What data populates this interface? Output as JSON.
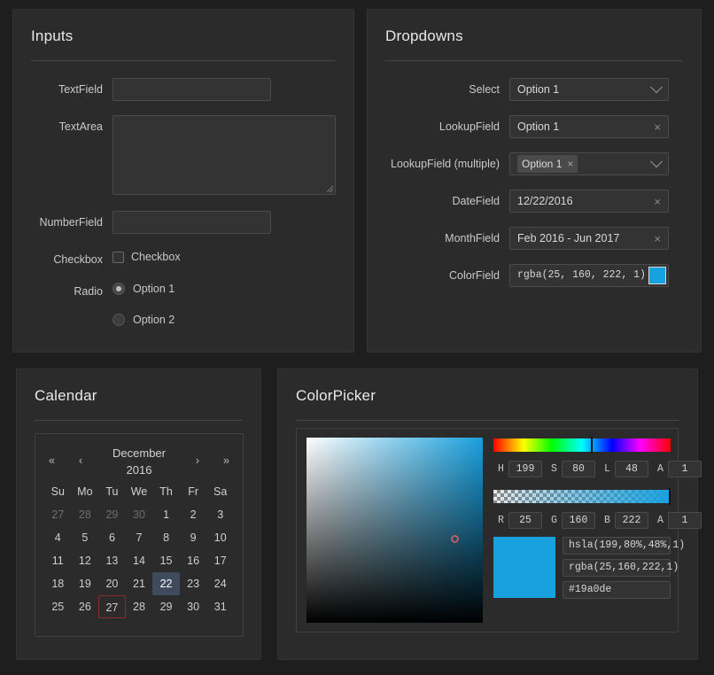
{
  "panels": {
    "inputs": {
      "title": "Inputs"
    },
    "dropdowns": {
      "title": "Dropdowns"
    },
    "calendar": {
      "title": "Calendar"
    },
    "colorpicker": {
      "title": "ColorPicker"
    }
  },
  "inputs": {
    "textfield": {
      "label": "TextField",
      "value": "",
      "placeholder": ""
    },
    "textarea": {
      "label": "TextArea",
      "value": "",
      "placeholder": ""
    },
    "numberfield": {
      "label": "NumberField",
      "value": "",
      "placeholder": ""
    },
    "checkbox": {
      "label": "Checkbox",
      "text": "Checkbox",
      "checked": false
    },
    "radio": {
      "label": "Radio",
      "options": [
        {
          "text": "Option 1",
          "selected": true
        },
        {
          "text": "Option 2",
          "selected": false
        }
      ]
    }
  },
  "dropdowns": {
    "select": {
      "label": "Select",
      "value": "Option 1",
      "caret": "chevron-down-icon"
    },
    "lookup": {
      "label": "LookupField",
      "value": "Option 1",
      "clear": "×"
    },
    "lookup_multiple": {
      "label": "LookupField (multiple)",
      "tag": "Option 1",
      "tag_remove": "×",
      "caret": "chevron-down-icon"
    },
    "datefield": {
      "label": "DateField",
      "value": "12/22/2016",
      "clear": "×"
    },
    "monthfield": {
      "label": "MonthField",
      "value": "Feb 2016 - Jun 2017",
      "clear": "×"
    },
    "colorfield": {
      "label": "ColorField",
      "value": "rgba(25, 160, 222, 1)",
      "swatch": "#19a0de"
    }
  },
  "calendar": {
    "month": "December",
    "year": "2016",
    "nav": {
      "first": "«",
      "prev": "‹",
      "next": "›",
      "last": "»"
    },
    "dow": [
      "Su",
      "Mo",
      "Tu",
      "We",
      "Th",
      "Fr",
      "Sa"
    ],
    "weeks": [
      [
        {
          "d": "27",
          "m": true
        },
        {
          "d": "28",
          "m": true
        },
        {
          "d": "29",
          "m": true
        },
        {
          "d": "30",
          "m": true
        },
        {
          "d": "1"
        },
        {
          "d": "2"
        },
        {
          "d": "3"
        }
      ],
      [
        {
          "d": "4"
        },
        {
          "d": "5"
        },
        {
          "d": "6"
        },
        {
          "d": "7"
        },
        {
          "d": "8"
        },
        {
          "d": "9"
        },
        {
          "d": "10"
        }
      ],
      [
        {
          "d": "11"
        },
        {
          "d": "12"
        },
        {
          "d": "13"
        },
        {
          "d": "14"
        },
        {
          "d": "15"
        },
        {
          "d": "16"
        },
        {
          "d": "17"
        }
      ],
      [
        {
          "d": "18"
        },
        {
          "d": "19"
        },
        {
          "d": "20"
        },
        {
          "d": "21"
        },
        {
          "d": "22",
          "sel": true
        },
        {
          "d": "23"
        },
        {
          "d": "24"
        }
      ],
      [
        {
          "d": "25"
        },
        {
          "d": "26"
        },
        {
          "d": "27",
          "today": true
        },
        {
          "d": "28"
        },
        {
          "d": "29"
        },
        {
          "d": "30"
        },
        {
          "d": "31"
        }
      ]
    ],
    "selected_day": "22",
    "today": "27"
  },
  "colorpicker": {
    "hue_label": "H",
    "hue_value": "199",
    "sat_label": "S",
    "sat_value": "80",
    "lig_label": "L",
    "lig_value": "48",
    "alpha_label": "A",
    "alpha_value": "1",
    "r_label": "R",
    "r_value": "25",
    "g_label": "G",
    "g_value": "160",
    "b_label": "B",
    "b_value": "222",
    "alpha2_label": "A",
    "alpha2_value": "1",
    "hsla": "hsla(199,80%,48%,1)",
    "rgba": "rgba(25,160,222,1)",
    "hex": "#19a0de",
    "current_color": "#19a0de"
  }
}
